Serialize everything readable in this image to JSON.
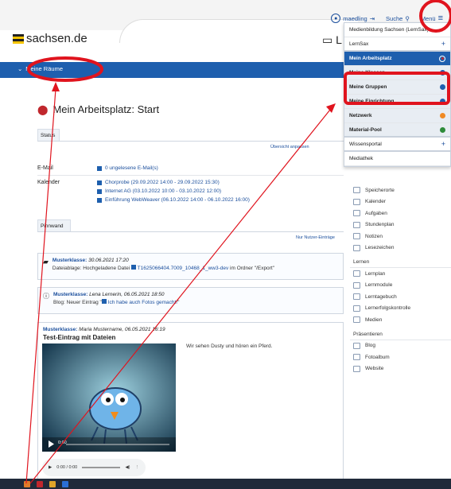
{
  "header": {
    "logo_text": "sachsen.de",
    "user_name": "maedling",
    "search_label": "Suche",
    "menu_label": "Menü",
    "l_mark": "L"
  },
  "nav": {
    "rooms_label": "Meine Räume"
  },
  "page": {
    "title": "Mein Arbeitsplatz: Start",
    "status_tab": "Status",
    "overview_link": "Übersicht anpassen",
    "email_label": "E-Mail",
    "email_value": "0 ungelesene E-Mail(s)",
    "calendar_label": "Kalender",
    "calendar_items": [
      "Chorprobe (29.09.2022 14:00 - 29.09.2022 15:30)",
      "Internet AG (03.10.2022 10:00 - 03.10.2022 12:00)",
      "Einführung WebWeaver (06.10.2022 14:00 - 06.10.2022 16:00)"
    ],
    "pinboard_tab": "Pinnwand",
    "only_user_link": "Nur Nutzer-Einträge"
  },
  "posts": [
    {
      "source": "Musterklasse:",
      "meta": "30.06.2021 17:20",
      "body_prefix": "Dateiablage: Hochgeladene Datei",
      "body_link": "T1625066404.7009_10468_1_ww3-dev",
      "body_suffix": "im Ordner \"/Export\""
    },
    {
      "source": "Musterklasse:",
      "meta": "Lena Lernerin",
      "meta2": ", 06.05.2021 18:50",
      "body_prefix": "Blog: Neuer Eintrag \"",
      "body_link": "Ich habe auch Fotos gemacht!",
      "body_suffix": "\""
    }
  ],
  "big_post": {
    "source": "Musterklasse:",
    "meta": "Maria Mustername",
    "meta2": ", 06.05.2021 16:19",
    "heading": "Test-Eintrag mit Dateien",
    "caption": "Wir sehen Dusty und hören ein Pferd.",
    "video_time": "0:00",
    "audio_time": "0:00 / 0:00"
  },
  "menu": {
    "items": [
      {
        "label": "Medienbildung Sachsen (LernSax)",
        "style": "plain",
        "marker": ""
      },
      {
        "label": "LernSax",
        "style": "plain",
        "marker": "plus"
      },
      {
        "label": "Mein Arbeitsplatz",
        "style": "sel",
        "marker": "ring"
      },
      {
        "label": "Meine Klassen",
        "style": "grey",
        "marker": "dot",
        "color": "#1e5fae"
      },
      {
        "label": "Meine Gruppen",
        "style": "grey",
        "marker": "dot",
        "color": "#1e5fae"
      },
      {
        "label": "Meine Einrichtung",
        "style": "grey",
        "marker": "dot",
        "color": "#1e5fae"
      },
      {
        "label": "Netzwerk",
        "style": "grey",
        "marker": "dot",
        "color": "#f08a24"
      },
      {
        "label": "Material-Pool",
        "style": "grey",
        "marker": "dot",
        "color": "#2e8b3a"
      },
      {
        "label": "Wissensportal",
        "style": "plain",
        "marker": "plus"
      },
      {
        "label": "Mediathek",
        "style": "plain",
        "marker": ""
      }
    ]
  },
  "sidebar": {
    "tools": [
      "Speicherorte",
      "Kalender",
      "Aufgaben",
      "Stundenplan",
      "Notizen",
      "Lesezeichen"
    ],
    "lernen_head": "Lernen",
    "lernen": [
      "Lernplan",
      "Lernmodule",
      "Lerntagebuch",
      "Lernerfolgskontrolle",
      "Medien"
    ],
    "praes_head": "Präsentieren",
    "praes": [
      "Blog",
      "Fotoalbum",
      "Website"
    ]
  },
  "colors": {
    "accent": "#1e5fae",
    "annotation": "#e0141e"
  }
}
